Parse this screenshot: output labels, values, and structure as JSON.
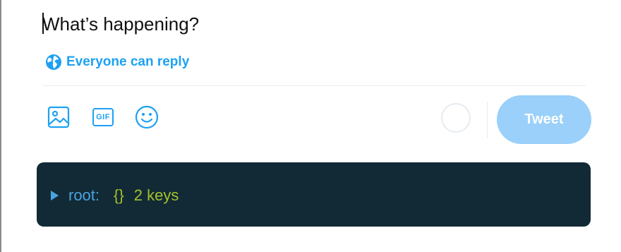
{
  "compose": {
    "placeholder": "What’s happening?"
  },
  "reply_setting": {
    "label": "Everyone can reply",
    "icon": "globe-icon"
  },
  "toolbar": {
    "media_icon": "image-icon",
    "gif_label": "GIF",
    "emoji_icon": "emoji-icon",
    "tweet_label": "Tweet"
  },
  "json_viewer": {
    "key": "root",
    "colon": ":",
    "type_braces": "{}",
    "count_label": "2 keys"
  },
  "colors": {
    "accent": "#1da1f2",
    "tweet_button_disabled": "#9ad0f9",
    "viewer_background": "#122a35",
    "viewer_key": "#4aa3e0",
    "viewer_value": "#a4c22c"
  }
}
